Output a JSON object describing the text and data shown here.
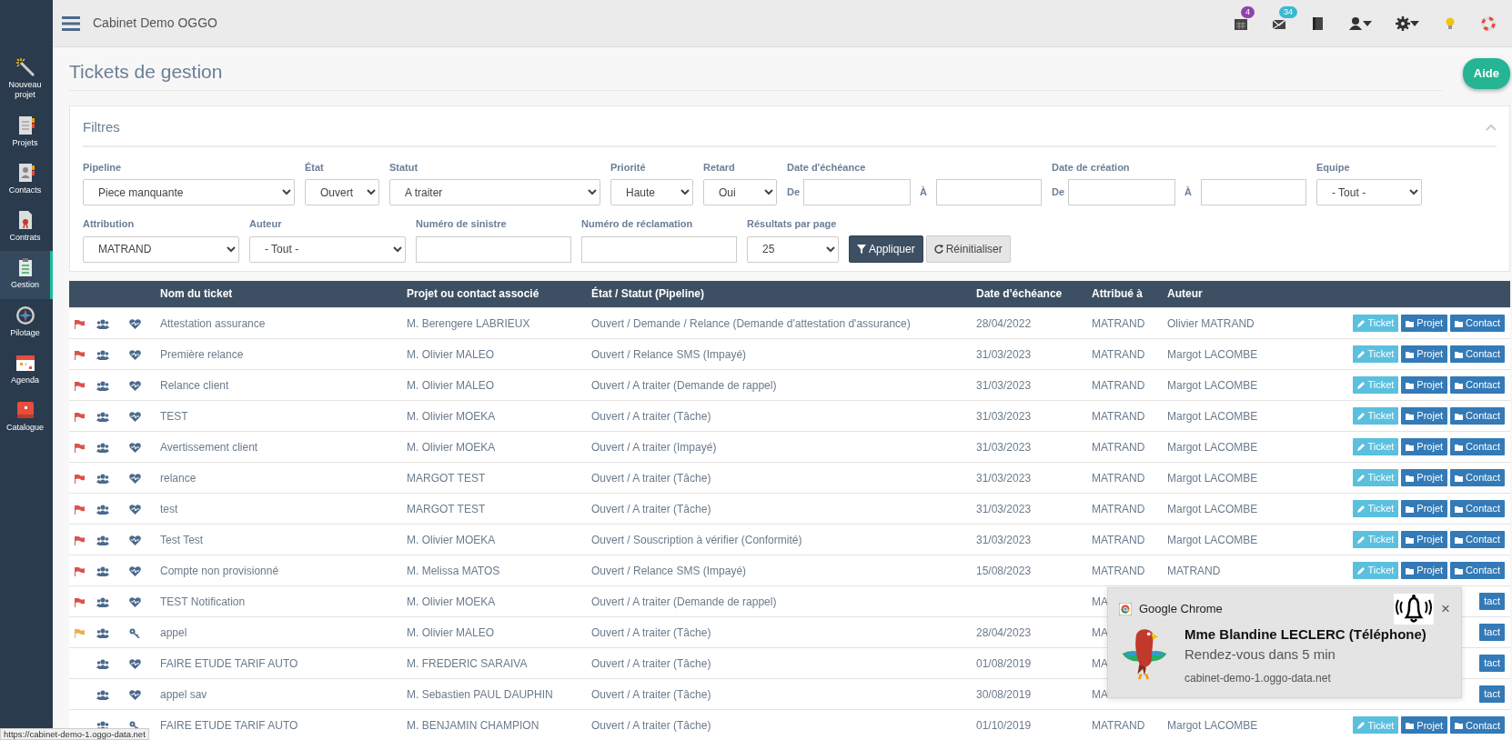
{
  "sidebar": {
    "items": [
      {
        "label": "Nouveau projet",
        "kind": "wand",
        "selected": false
      },
      {
        "label": "Projets",
        "kind": "planner",
        "selected": false
      },
      {
        "label": "Contacts",
        "kind": "contacts",
        "selected": false
      },
      {
        "label": "Contrats",
        "kind": "contract",
        "selected": false
      },
      {
        "label": "Gestion",
        "kind": "clipboard",
        "selected": true
      },
      {
        "label": "Pilotage",
        "kind": "compass",
        "selected": false
      },
      {
        "label": "Agenda",
        "kind": "calendar",
        "selected": false
      },
      {
        "label": "Catalogue",
        "kind": "catalogue",
        "selected": false
      }
    ]
  },
  "topbar": {
    "title": "Cabinet Demo OGGO",
    "icons": [
      {
        "kind": "calendar",
        "badge": "4",
        "color": "#8e44ad"
      },
      {
        "kind": "mail",
        "badge": "34",
        "color": "#3bb9d0"
      },
      {
        "kind": "book"
      },
      {
        "kind": "user"
      },
      {
        "kind": "gear"
      },
      {
        "kind": "bulb"
      },
      {
        "kind": "lifebuoy"
      }
    ]
  },
  "page": {
    "title": "Tickets de gestion",
    "help_button": "Aide"
  },
  "filters": {
    "title": "Filtres",
    "fields": [
      {
        "kind": "select",
        "label": "Pipeline",
        "value": "Piece manquante"
      },
      {
        "kind": "select",
        "label": "État",
        "value": "Ouvert"
      },
      {
        "kind": "select",
        "label": "Statut",
        "value": "A traiter"
      },
      {
        "kind": "select",
        "label": "Priorité",
        "value": "Haute"
      },
      {
        "kind": "select",
        "label": "Retard",
        "value": "Oui"
      },
      {
        "kind": "daterange",
        "label": "Date d'échéance",
        "from": "De",
        "to": "À"
      },
      {
        "kind": "daterange",
        "label": "Date de création",
        "from": "De",
        "to": "À"
      },
      {
        "kind": "select",
        "label": "Equipe",
        "value": "- Tout -"
      },
      {
        "kind": "select",
        "label": "Attribution",
        "value": "MATRAND"
      },
      {
        "kind": "select",
        "label": "Auteur",
        "value": "- Tout -"
      },
      {
        "kind": "input",
        "label": "Numéro de sinistre"
      },
      {
        "kind": "input",
        "label": "Numéro de réclamation"
      },
      {
        "kind": "select",
        "label": "Résultats par page",
        "value": "25"
      },
      {
        "kind": "apply",
        "label": "Appliquer"
      },
      {
        "kind": "reset",
        "label": "Réinitialiser"
      }
    ]
  },
  "table": {
    "columns": [
      "Nom du ticket",
      "Projet ou contact associé",
      "État / Statut (Pipeline)",
      "Date d'échéance",
      "Attribué à",
      "Auteur"
    ],
    "rows": [
      {
        "color": "#d9534f",
        "kind": "heartbeat",
        "name": "Attestation assurance",
        "project": "M. Berengere LABRIEUX",
        "status": "Ouvert / Demande / Relance (Demande d'attestation d'assurance)",
        "due": "28/04/2022",
        "assigned": "MATRAND",
        "author": "Olivier MATRAND",
        "covered": false,
        "actions": [
          "Ticket",
          "Projet",
          "Contact"
        ]
      },
      {
        "color": "#d9534f",
        "kind": "heartbeat",
        "name": "Première relance",
        "project": "M. Olivier MALEO",
        "status": "Ouvert / Relance SMS (Impayé)",
        "due": "31/03/2023",
        "assigned": "MATRAND",
        "author": "Margot LACOMBE",
        "covered": false,
        "actions": [
          "Ticket",
          "Projet",
          "Contact"
        ]
      },
      {
        "color": "#d9534f",
        "kind": "heartbeat",
        "name": "Relance client",
        "project": "M. Olivier MALEO",
        "status": "Ouvert / A traiter (Demande de rappel)",
        "due": "31/03/2023",
        "assigned": "MATRAND",
        "author": "Margot LACOMBE",
        "covered": false,
        "actions": [
          "Ticket",
          "Projet",
          "Contact"
        ]
      },
      {
        "color": "#d9534f",
        "kind": "heartbeat",
        "name": "TEST",
        "project": "M. Olivier MOEKA",
        "status": "Ouvert / A traiter (Tâche)",
        "due": "31/03/2023",
        "assigned": "MATRAND",
        "author": "Margot LACOMBE",
        "covered": false,
        "actions": [
          "Ticket",
          "Projet",
          "Contact"
        ]
      },
      {
        "color": "#d9534f",
        "kind": "heartbeat",
        "name": "Avertissement client",
        "project": "M. Olivier MOEKA",
        "status": "Ouvert / A traiter (Impayé)",
        "due": "31/03/2023",
        "assigned": "MATRAND",
        "author": "Margot LACOMBE",
        "covered": false,
        "actions": [
          "Ticket",
          "Projet",
          "Contact"
        ]
      },
      {
        "color": "#d9534f",
        "kind": "heartbeat",
        "name": "relance",
        "project": "MARGOT TEST",
        "status": "Ouvert / A traiter (Tâche)",
        "due": "31/03/2023",
        "assigned": "MATRAND",
        "author": "Margot LACOMBE",
        "covered": false,
        "actions": [
          "Ticket",
          "Projet",
          "Contact"
        ]
      },
      {
        "color": "#d9534f",
        "kind": "heartbeat",
        "name": "test",
        "project": "MARGOT TEST",
        "status": "Ouvert / A traiter (Tâche)",
        "due": "31/03/2023",
        "assigned": "MATRAND",
        "author": "Margot LACOMBE",
        "covered": false,
        "actions": [
          "Ticket",
          "Projet",
          "Contact"
        ]
      },
      {
        "color": "#d9534f",
        "kind": "heartbeat",
        "name": "Test Test",
        "project": "M. Olivier MOEKA",
        "status": "Ouvert / Souscription à vérifier (Conformité)",
        "due": "31/03/2023",
        "assigned": "MATRAND",
        "author": "Margot LACOMBE",
        "covered": false,
        "actions": [
          "Ticket",
          "Projet",
          "Contact"
        ]
      },
      {
        "color": "#d9534f",
        "kind": "heartbeat",
        "name": "Compte non provisionné",
        "project": "M. Melissa MATOS",
        "status": "Ouvert / Relance SMS (Impayé)",
        "due": "15/08/2023",
        "assigned": "MATRAND",
        "author": "MATRAND",
        "covered": false,
        "actions": [
          "Ticket",
          "Projet",
          "Contact"
        ]
      },
      {
        "color": "#d9534f",
        "kind": "heartbeat",
        "name": "TEST Notification",
        "project": "M. Olivier MOEKA",
        "status": "Ouvert / A traiter (Demande de rappel)",
        "assigned": "MA",
        "covered": true,
        "actions": [
          "tact"
        ]
      },
      {
        "color": "#f0ad4e",
        "kind": "key",
        "name": "appel",
        "project": "M. Olivier MALEO",
        "status": "Ouvert / A traiter (Tâche)",
        "due": "28/04/2023",
        "assigned": "MA",
        "covered": true,
        "actions": [
          "tact"
        ]
      },
      {
        "kind": "heartbeat",
        "name": "FAIRE ETUDE TARIF AUTO",
        "project": "M. FREDERIC SARAIVA",
        "status": "Ouvert / A traiter (Tâche)",
        "due": "01/08/2019",
        "assigned": "MA",
        "covered": true,
        "actions": [
          "tact"
        ]
      },
      {
        "kind": "heartbeat",
        "name": "appel sav",
        "project": "M. Sebastien PAUL DAUPHIN",
        "status": "Ouvert / A traiter (Tâche)",
        "due": "30/08/2019",
        "assigned": "MA",
        "covered": true,
        "actions": [
          "tact"
        ]
      },
      {
        "kind": "key",
        "name": "FAIRE ETUDE TARIF AUTO",
        "project": "M. BENJAMIN CHAMPION",
        "status": "Ouvert / A traiter (Tâche)",
        "due": "01/10/2019",
        "assigned": "MATRAND",
        "author": "Margot LACOMBE",
        "covered": false,
        "actions": [
          "Ticket",
          "Projet",
          "Contact"
        ]
      }
    ]
  },
  "notification": {
    "app": "Google Chrome",
    "close": "×",
    "title": "Mme Blandine LECLERC (Téléphone)",
    "message": "Rendez-vous dans 5 min",
    "source": "cabinet-demo-1.oggo-data.net"
  },
  "status_url": "https://cabinet-demo-1.oggo-data.net"
}
